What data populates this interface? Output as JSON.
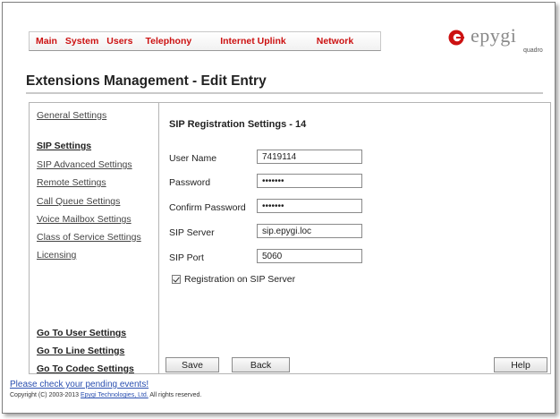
{
  "nav": {
    "items": [
      "Main",
      "System",
      "Users",
      "Telephony",
      "Internet Uplink",
      "Network"
    ]
  },
  "logo": {
    "text": "epygi",
    "sub": "quadro"
  },
  "page": {
    "title": "Extensions Management - Edit Entry"
  },
  "sidebar": {
    "links": [
      "General Settings",
      "SIP Settings",
      "SIP Advanced Settings",
      "Remote Settings",
      "Call Queue Settings",
      "Voice Mailbox Settings",
      "Class of Service Settings",
      "Licensing"
    ],
    "goto": [
      "Go To User Settings",
      "Go To Line Settings",
      "Go To Codec Settings"
    ]
  },
  "form": {
    "heading": "SIP Registration Settings - 14",
    "fields": [
      {
        "label": "User Name",
        "value": "7419114"
      },
      {
        "label": "Password",
        "value": "•••••••"
      },
      {
        "label": "Confirm Password",
        "value": "•••••••"
      },
      {
        "label": "SIP Server",
        "value": "sip.epygi.loc"
      },
      {
        "label": "SIP Port",
        "value": "5060"
      }
    ],
    "checkbox": {
      "label": "Registration on SIP Server",
      "checked": true
    }
  },
  "buttons": {
    "save": "Save",
    "back": "Back",
    "help": "Help"
  },
  "footer": {
    "pending": "Please check your pending events!",
    "copyright_prefix": "Copyright (C) 2003-2013",
    "copyright_link": "Epygi Technologies, Ltd.",
    "copyright_suffix": "All rights reserved."
  },
  "colors": {
    "nav_text": "#cc1111",
    "logo_mark": "#cc1111",
    "link_blue": "#2a4fb0"
  }
}
